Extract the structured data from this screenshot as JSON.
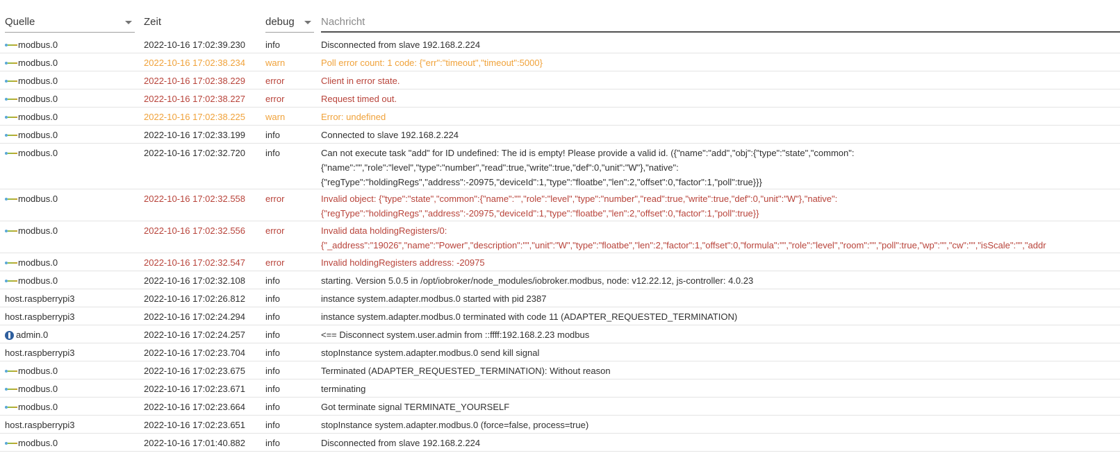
{
  "header": {
    "source_label": "Quelle",
    "time_label": "Zeit",
    "severity_label": "debug",
    "message_placeholder": "Nachricht"
  },
  "colors": {
    "warn": "#f0a23a",
    "error": "#b8433a",
    "info": "#303030"
  },
  "rows": [
    {
      "source": "modbus.0",
      "icon": "modbus-adapter-icon",
      "time": "2022-10-16 17:02:39.230",
      "severity": "info",
      "message": [
        "Disconnected from slave 192.168.2.224"
      ]
    },
    {
      "source": "modbus.0",
      "icon": "modbus-adapter-icon",
      "time": "2022-10-16 17:02:38.234",
      "severity": "warn",
      "message": [
        "Poll error count: 1 code: {\"err\":\"timeout\",\"timeout\":5000}"
      ]
    },
    {
      "source": "modbus.0",
      "icon": "modbus-adapter-icon",
      "time": "2022-10-16 17:02:38.229",
      "severity": "error",
      "message": [
        "Client in error state."
      ]
    },
    {
      "source": "modbus.0",
      "icon": "modbus-adapter-icon",
      "time": "2022-10-16 17:02:38.227",
      "severity": "error",
      "message": [
        "Request timed out."
      ]
    },
    {
      "source": "modbus.0",
      "icon": "modbus-adapter-icon",
      "time": "2022-10-16 17:02:38.225",
      "severity": "warn",
      "message": [
        "Error: undefined"
      ]
    },
    {
      "source": "modbus.0",
      "icon": "modbus-adapter-icon",
      "time": "2022-10-16 17:02:33.199",
      "severity": "info",
      "message": [
        "Connected to slave 192.168.2.224"
      ]
    },
    {
      "source": "modbus.0",
      "icon": "modbus-adapter-icon",
      "time": "2022-10-16 17:02:32.720",
      "severity": "info",
      "message": [
        "Can not execute task \"add\" for ID undefined: The id is empty! Please provide a valid id. ({\"name\":\"add\",\"obj\":{\"type\":\"state\",\"common\":",
        "{\"name\":\"\",\"role\":\"level\",\"type\":\"number\",\"read\":true,\"write\":true,\"def\":0,\"unit\":\"W\"},\"native\":",
        "{\"regType\":\"holdingRegs\",\"address\":-20975,\"deviceId\":1,\"type\":\"floatbe\",\"len\":2,\"offset\":0,\"factor\":1,\"poll\":true}}}"
      ]
    },
    {
      "source": "modbus.0",
      "icon": "modbus-adapter-icon",
      "time": "2022-10-16 17:02:32.558",
      "severity": "error",
      "message": [
        "Invalid object: {\"type\":\"state\",\"common\":{\"name\":\"\",\"role\":\"level\",\"type\":\"number\",\"read\":true,\"write\":true,\"def\":0,\"unit\":\"W\"},\"native\":",
        "{\"regType\":\"holdingRegs\",\"address\":-20975,\"deviceId\":1,\"type\":\"floatbe\",\"len\":2,\"offset\":0,\"factor\":1,\"poll\":true}}"
      ]
    },
    {
      "source": "modbus.0",
      "icon": "modbus-adapter-icon",
      "time": "2022-10-16 17:02:32.556",
      "severity": "error",
      "message": [
        "Invalid data holdingRegisters/0:",
        "{\"_address\":\"19026\",\"name\":\"Power\",\"description\":\"\",\"unit\":\"W\",\"type\":\"floatbe\",\"len\":2,\"factor\":1,\"offset\":0,\"formula\":\"\",\"role\":\"level\",\"room\":\"\",\"poll\":true,\"wp\":\"\",\"cw\":\"\",\"isScale\":\"\",\"addr"
      ]
    },
    {
      "source": "modbus.0",
      "icon": "modbus-adapter-icon",
      "time": "2022-10-16 17:02:32.547",
      "severity": "error",
      "message": [
        "Invalid holdingRegisters address: -20975"
      ]
    },
    {
      "source": "modbus.0",
      "icon": "modbus-adapter-icon",
      "time": "2022-10-16 17:02:32.108",
      "severity": "info",
      "message": [
        "starting. Version 5.0.5 in /opt/iobroker/node_modules/iobroker.modbus, node: v12.22.12, js-controller: 4.0.23"
      ]
    },
    {
      "source": "host.raspberrypi3",
      "icon": "",
      "time": "2022-10-16 17:02:26.812",
      "severity": "info",
      "message": [
        "instance system.adapter.modbus.0 started with pid 2387"
      ]
    },
    {
      "source": "host.raspberrypi3",
      "icon": "",
      "time": "2022-10-16 17:02:24.294",
      "severity": "info",
      "message": [
        "instance system.adapter.modbus.0 terminated with code 11 (ADAPTER_REQUESTED_TERMINATION)"
      ]
    },
    {
      "source": "admin.0",
      "icon": "admin-adapter-icon",
      "time": "2022-10-16 17:02:24.257",
      "severity": "info",
      "message": [
        "<== Disconnect system.user.admin from ::ffff:192.168.2.23 modbus"
      ]
    },
    {
      "source": "host.raspberrypi3",
      "icon": "",
      "time": "2022-10-16 17:02:23.704",
      "severity": "info",
      "message": [
        "stopInstance system.adapter.modbus.0 send kill signal"
      ]
    },
    {
      "source": "modbus.0",
      "icon": "modbus-adapter-icon",
      "time": "2022-10-16 17:02:23.675",
      "severity": "info",
      "message": [
        "Terminated (ADAPTER_REQUESTED_TERMINATION): Without reason"
      ]
    },
    {
      "source": "modbus.0",
      "icon": "modbus-adapter-icon",
      "time": "2022-10-16 17:02:23.671",
      "severity": "info",
      "message": [
        "terminating"
      ]
    },
    {
      "source": "modbus.0",
      "icon": "modbus-adapter-icon",
      "time": "2022-10-16 17:02:23.664",
      "severity": "info",
      "message": [
        "Got terminate signal TERMINATE_YOURSELF"
      ]
    },
    {
      "source": "host.raspberrypi3",
      "icon": "",
      "time": "2022-10-16 17:02:23.651",
      "severity": "info",
      "message": [
        "stopInstance system.adapter.modbus.0 (force=false, process=true)"
      ]
    },
    {
      "source": "modbus.0",
      "icon": "modbus-adapter-icon",
      "time": "2022-10-16 17:01:40.882",
      "severity": "info",
      "message": [
        "Disconnected from slave 192.168.2.224"
      ]
    }
  ]
}
